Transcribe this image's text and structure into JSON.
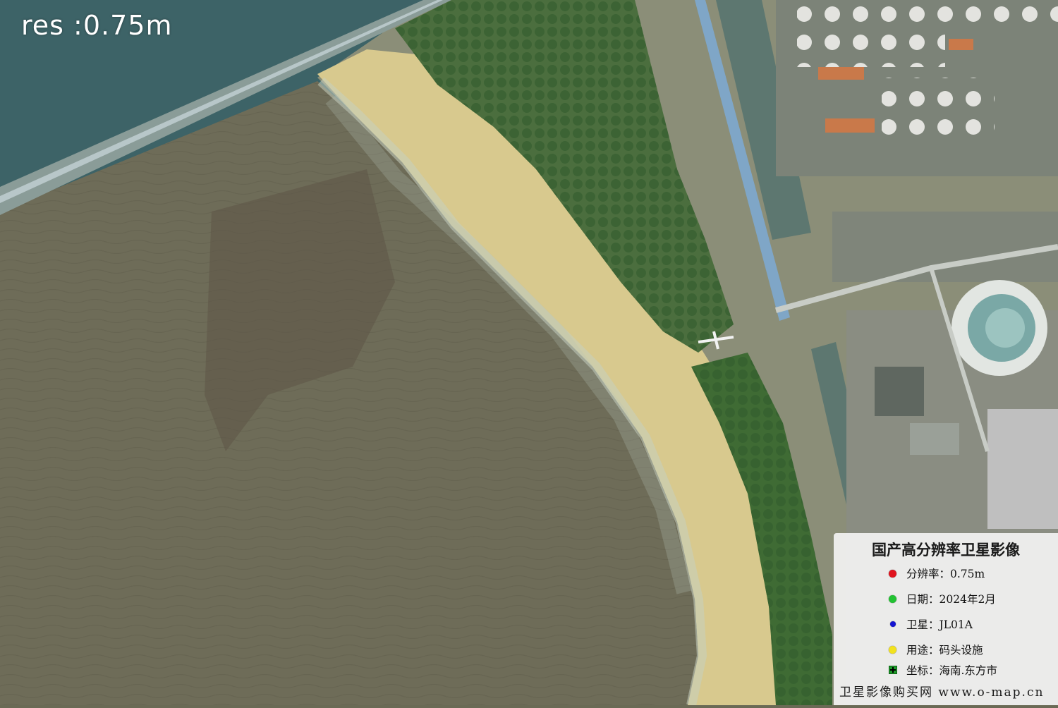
{
  "overlay": {
    "resolution_text": "res :0.75m"
  },
  "legend": {
    "title": "国产高分辨率卫星影像",
    "items": [
      {
        "label": "分辨率：0.75m",
        "color": "#e0141e"
      },
      {
        "label": "日期：2024年2月",
        "color": "#22c232"
      },
      {
        "label": "卫星：JL01A",
        "color": "#1414d2"
      },
      {
        "label": "用途：码头设施",
        "color": "#f2e21e"
      },
      {
        "label": "坐标：海南.东方市",
        "color": "#1d9b2a"
      }
    ],
    "footer": "卫星影像购买网  www.o-map.cn"
  },
  "colors": {
    "open_sea": "#3d6367",
    "near_sea": "#6e6c58",
    "surf": "#bfc8b8",
    "beach": "#d8c98e",
    "vegetation": "#3f6b34",
    "industrial": "#7c8378",
    "canal": "#5d7770"
  }
}
